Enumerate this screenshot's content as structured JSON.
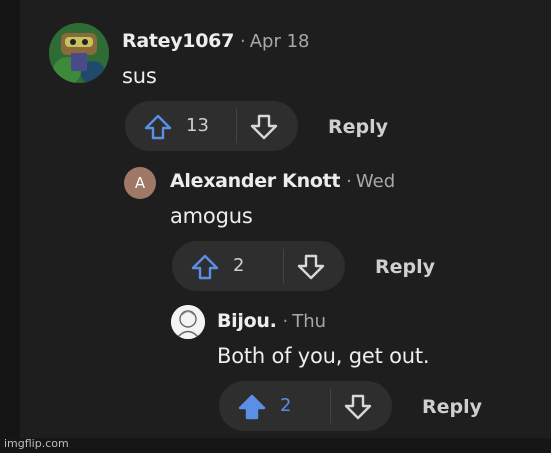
{
  "colors": {
    "background": "#1e1e1e",
    "pill": "#2e2e2e",
    "accent": "#5b8fe6",
    "text": "#ededed",
    "muted": "#a8a8a8"
  },
  "comments": [
    {
      "username": "Ratey1067",
      "separator": "·",
      "date": "Apr 18",
      "body": "sus",
      "votes": "13",
      "reply_label": "Reply",
      "upvoted": false
    },
    {
      "username": "Alexander Knott",
      "separator": "·",
      "date": "Wed",
      "body": "amogus",
      "votes": "2",
      "reply_label": "Reply",
      "avatar_letter": "A",
      "upvoted": false
    },
    {
      "username": "Bijou.",
      "separator": "·",
      "date": "Thu",
      "body": "Both of you, get out.",
      "votes": "2",
      "reply_label": "Reply",
      "upvoted": true
    }
  ],
  "watermark": "imgflip.com",
  "icons": {
    "upvote": "arrow-up-icon",
    "downvote": "arrow-down-icon"
  }
}
